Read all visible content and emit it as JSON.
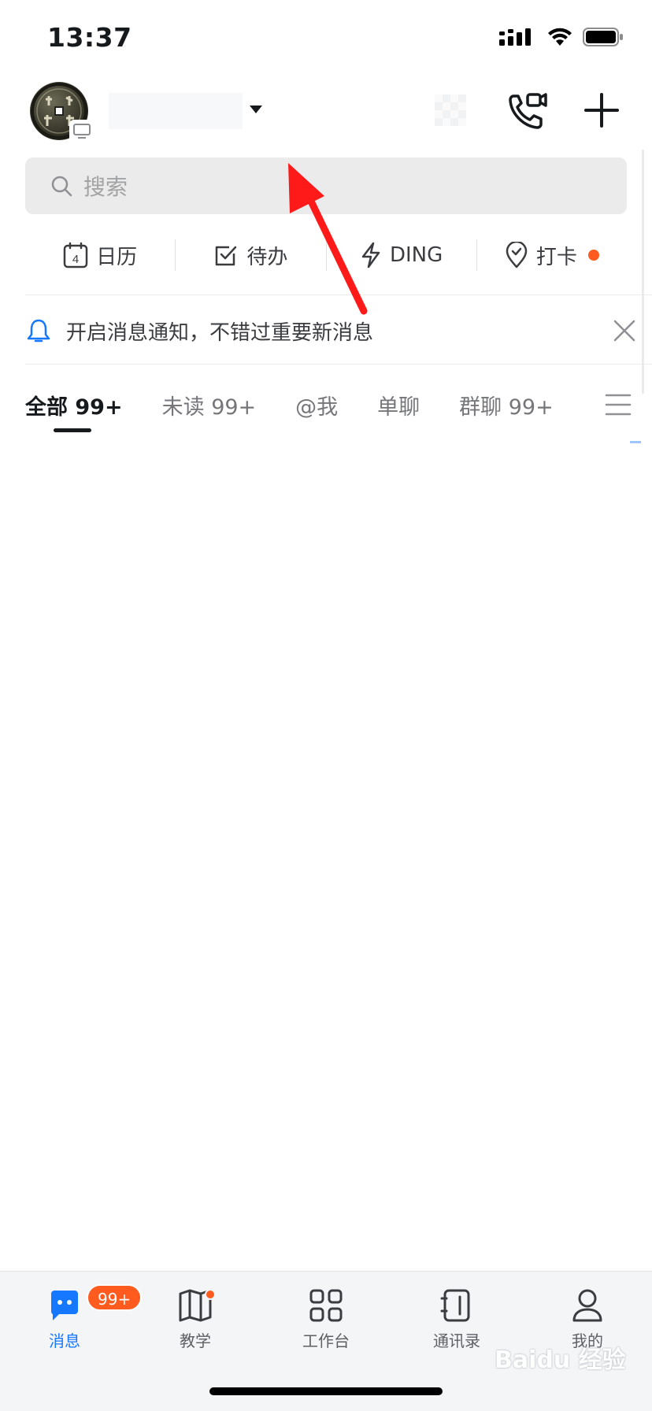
{
  "status_bar": {
    "time": "13:37"
  },
  "header": {
    "avatar": "avatar-icon",
    "org_caret": "caret-down-icon"
  },
  "search": {
    "placeholder": "搜索"
  },
  "quick_bar": {
    "items": [
      {
        "label": "日历",
        "icon": "calendar-icon",
        "icon_text": "4"
      },
      {
        "label": "待办",
        "icon": "checkbox-icon"
      },
      {
        "label": "DING",
        "icon": "lightning-icon"
      },
      {
        "label": "打卡",
        "icon": "location-icon",
        "has_dot": true
      }
    ]
  },
  "notify": {
    "text": "开启消息通知，不错过重要新消息"
  },
  "tabs": [
    {
      "label": "全部 99+",
      "active": true
    },
    {
      "label": "未读 99+"
    },
    {
      "label": "@我"
    },
    {
      "label": "单聊"
    },
    {
      "label": "群聊 99+"
    }
  ],
  "bottom_nav": [
    {
      "label": "消息",
      "active": true,
      "badge": "99+"
    },
    {
      "label": "教学",
      "dot": true
    },
    {
      "label": "工作台"
    },
    {
      "label": "通讯录"
    },
    {
      "label": "我的"
    }
  ],
  "colors": {
    "accent": "#1677ff",
    "badge": "#ff5b1f",
    "annotation": "#ff1a1a"
  },
  "watermark": "Baidu 经验"
}
